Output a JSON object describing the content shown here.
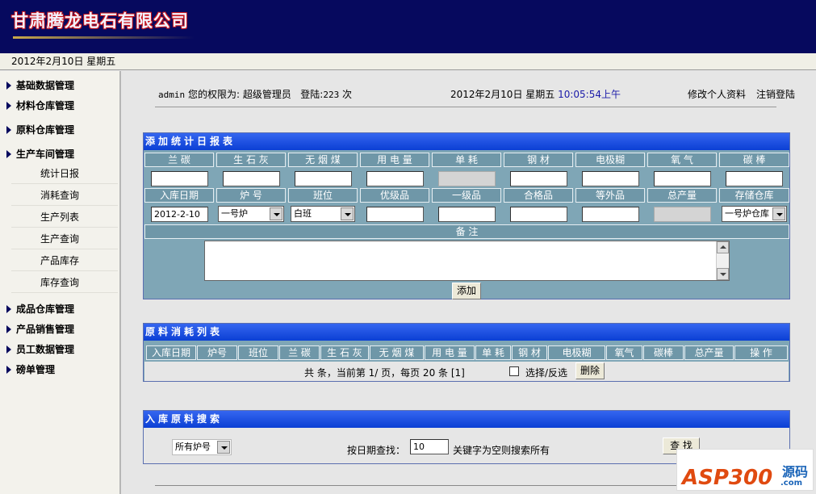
{
  "header": {
    "company": "甘肃腾龙电石有限公司"
  },
  "datebar": {
    "date": "2012年2月10日 星期五"
  },
  "sidebar": {
    "items": [
      {
        "label": "基础数据管理"
      },
      {
        "label": "材料仓库管理"
      },
      {
        "label": "原料仓库管理"
      },
      {
        "label": "生产车间管理"
      },
      {
        "label": "成品仓库管理"
      },
      {
        "label": "产品销售管理"
      },
      {
        "label": "员工数据管理"
      },
      {
        "label": "磅单管理"
      }
    ],
    "subitems": [
      {
        "label": "统计日报"
      },
      {
        "label": "消耗查询"
      },
      {
        "label": "生产列表"
      },
      {
        "label": "生产查询"
      },
      {
        "label": "产品库存"
      },
      {
        "label": "库存查询"
      }
    ]
  },
  "topinfo": {
    "user": "admin",
    "perm_prefix": "您的权限为:",
    "role": "超级管理员",
    "login_prefix": "登陆:",
    "login_count": "223",
    "login_suffix": "次",
    "date": "2012年2月10日 星期五",
    "time": "10:05:54上午",
    "edit_profile": "修改个人资料",
    "logout": "注销登陆"
  },
  "add_panel": {
    "title": "添加统计日报表",
    "row1_headers": [
      "兰 碳",
      "生 石 灰",
      "无 烟 煤",
      "用 电 量",
      "单 耗",
      "钢 材",
      "电极糊",
      "氧 气",
      "碳 棒"
    ],
    "row2_headers": [
      "入库日期",
      "炉 号",
      "班位",
      "优级品",
      "一级品",
      "合格品",
      "等外品",
      "总产量",
      "存储仓库"
    ],
    "date_value": "2012-2-10",
    "furnace_value": "一号炉",
    "shift_value": "白班",
    "warehouse_value": "一号炉仓库",
    "remark_label": "备 注",
    "add_button": "添加"
  },
  "consume_panel": {
    "title": "原料消耗列表",
    "headers": [
      "入库日期",
      "炉号",
      "班位",
      "兰 碳",
      "生 石 灰",
      "无 烟 煤",
      "用 电 量",
      "单 耗",
      "钢 材",
      "电极糊",
      "氧气",
      "碳棒",
      "总产量",
      "操 作"
    ],
    "pager": "共 条，当前第 1/ 页，每页 20 条 [1]",
    "select_label": "选择/反选",
    "delete_button": "删除"
  },
  "search_panel": {
    "title": "入库原料搜索",
    "furnace_select": "所有炉号",
    "date_label": "按日期查找：",
    "date_value": "10",
    "hint": "关键字为空则搜索所有",
    "search_button": "查 找"
  },
  "watermark": {
    "brand": "ASP300",
    "cn": "源码",
    "domain": ".com"
  }
}
